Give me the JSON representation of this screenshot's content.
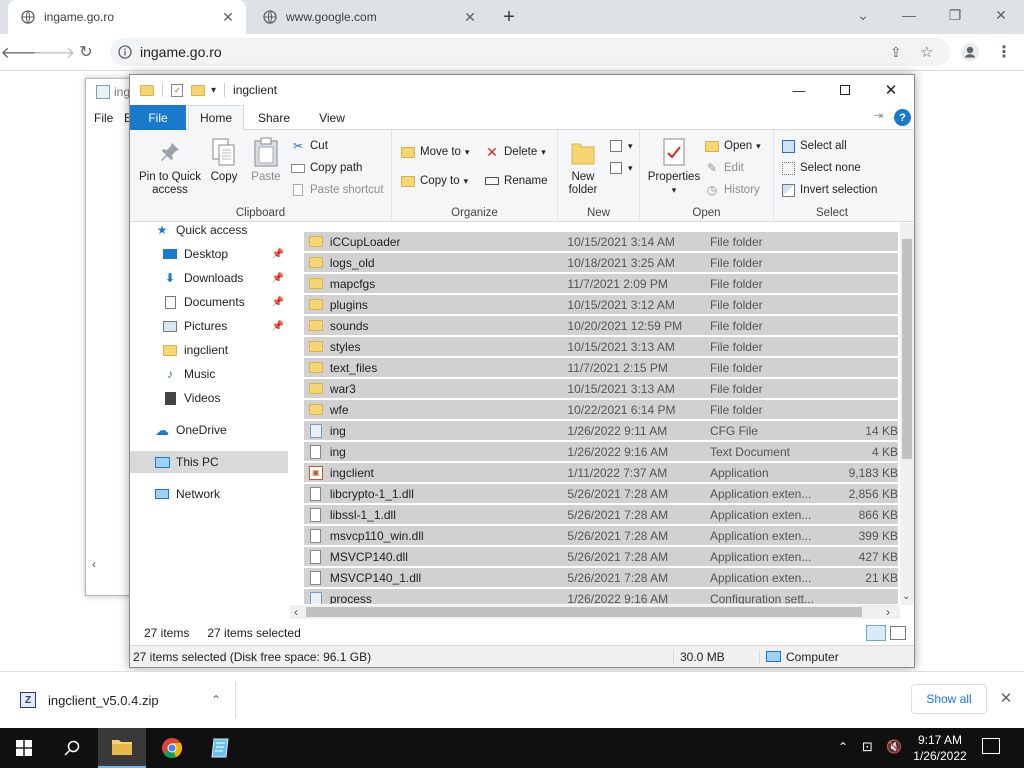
{
  "browser": {
    "tabs": [
      {
        "title": "ingame.go.ro",
        "active": true
      },
      {
        "title": "www.google.com",
        "active": false
      }
    ],
    "url": "ingame.go.ro"
  },
  "background_window": {
    "title_partial": "ing",
    "menu_file": "File",
    "menu_edit_partial": "E"
  },
  "explorer": {
    "title": "ingclient",
    "ribbon_tabs": [
      "File",
      "Home",
      "Share",
      "View"
    ],
    "clipboard": {
      "pin_label": "Pin to Quick access",
      "copy_label": "Copy",
      "paste_label": "Paste",
      "cut_label": "Cut",
      "copy_path_label": "Copy path",
      "paste_shortcut_label": "Paste shortcut",
      "group_label": "Clipboard"
    },
    "organize": {
      "move_to": "Move to",
      "copy_to": "Copy to",
      "delete": "Delete",
      "rename": "Rename",
      "group_label": "Organize"
    },
    "new": {
      "new_folder": "New folder",
      "group_label": "New"
    },
    "open": {
      "properties": "Properties",
      "open": "Open",
      "edit": "Edit",
      "history": "History",
      "group_label": "Open"
    },
    "select": {
      "select_all": "Select all",
      "select_none": "Select none",
      "invert_selection": "Invert selection",
      "group_label": "Select"
    },
    "nav": [
      {
        "label": "Quick access",
        "icon": "star-icon",
        "pinned": false
      },
      {
        "label": "Desktop",
        "icon": "desktop-icon",
        "pinned": true
      },
      {
        "label": "Downloads",
        "icon": "download-icon",
        "pinned": true
      },
      {
        "label": "Documents",
        "icon": "documents-icon",
        "pinned": true
      },
      {
        "label": "Pictures",
        "icon": "pictures-icon",
        "pinned": true
      },
      {
        "label": "ingclient",
        "icon": "folder-icon",
        "pinned": false
      },
      {
        "label": "Music",
        "icon": "music-icon",
        "pinned": false
      },
      {
        "label": "Videos",
        "icon": "videos-icon",
        "pinned": false
      },
      {
        "label": "OneDrive",
        "icon": "cloud-icon",
        "pinned": false
      },
      {
        "label": "This PC",
        "icon": "computer-icon",
        "pinned": false
      },
      {
        "label": "Network",
        "icon": "network-icon",
        "pinned": false
      }
    ],
    "files": [
      {
        "name": "iCCupLoader",
        "date": "10/15/2021 3:14 AM",
        "type": "File folder",
        "size": "",
        "icon": "folder-icon"
      },
      {
        "name": "logs_old",
        "date": "10/18/2021 3:25 AM",
        "type": "File folder",
        "size": "",
        "icon": "folder-icon"
      },
      {
        "name": "mapcfgs",
        "date": "11/7/2021 2:09 PM",
        "type": "File folder",
        "size": "",
        "icon": "folder-icon"
      },
      {
        "name": "plugins",
        "date": "10/15/2021 3:12 AM",
        "type": "File folder",
        "size": "",
        "icon": "folder-icon"
      },
      {
        "name": "sounds",
        "date": "10/20/2021 12:59 PM",
        "type": "File folder",
        "size": "",
        "icon": "folder-icon"
      },
      {
        "name": "styles",
        "date": "10/15/2021 3:13 AM",
        "type": "File folder",
        "size": "",
        "icon": "folder-icon"
      },
      {
        "name": "text_files",
        "date": "11/7/2021 2:15 PM",
        "type": "File folder",
        "size": "",
        "icon": "folder-icon"
      },
      {
        "name": "war3",
        "date": "10/15/2021 3:13 AM",
        "type": "File folder",
        "size": "",
        "icon": "folder-icon"
      },
      {
        "name": "wfe",
        "date": "10/22/2021 6:14 PM",
        "type": "File folder",
        "size": "",
        "icon": "folder-icon"
      },
      {
        "name": "ing",
        "date": "1/26/2022 9:11 AM",
        "type": "CFG File",
        "size": "14 KB",
        "icon": "config-file-icon"
      },
      {
        "name": "ing",
        "date": "1/26/2022 9:16 AM",
        "type": "Text Document",
        "size": "4 KB",
        "icon": "text-file-icon"
      },
      {
        "name": "ingclient",
        "date": "1/11/2022 7:37 AM",
        "type": "Application",
        "size": "9,183 KB",
        "icon": "application-icon"
      },
      {
        "name": "libcrypto-1_1.dll",
        "date": "5/26/2021 7:28 AM",
        "type": "Application exten...",
        "size": "2,856 KB",
        "icon": "dll-file-icon"
      },
      {
        "name": "libssl-1_1.dll",
        "date": "5/26/2021 7:28 AM",
        "type": "Application exten...",
        "size": "866 KB",
        "icon": "dll-file-icon"
      },
      {
        "name": "msvcp110_win.dll",
        "date": "5/26/2021 7:28 AM",
        "type": "Application exten...",
        "size": "399 KB",
        "icon": "dll-file-icon"
      },
      {
        "name": "MSVCP140.dll",
        "date": "5/26/2021 7:28 AM",
        "type": "Application exten...",
        "size": "427 KB",
        "icon": "dll-file-icon"
      },
      {
        "name": "MSVCP140_1.dll",
        "date": "5/26/2021 7:28 AM",
        "type": "Application exten...",
        "size": "21 KB",
        "icon": "dll-file-icon"
      },
      {
        "name": "process",
        "date": "1/26/2022 9:16 AM",
        "type": "Configuration sett...",
        "size": "",
        "icon": "config-file-icon"
      }
    ],
    "status": {
      "items": "27 items",
      "selected": "27 items selected",
      "details_left": "27 items selected (Disk free space: 96.1 GB)",
      "details_size": "30.0 MB",
      "details_location": "Computer"
    }
  },
  "download_shelf": {
    "filename": "ingclient_v5.0.4.zip",
    "show_all": "Show all"
  },
  "taskbar": {
    "time": "9:17 AM",
    "date": "1/26/2022"
  },
  "colors": {
    "file_tab": "#1979ca",
    "selection": "#d1d1d1",
    "taskbar": "#101010",
    "folder": "#f7d672"
  }
}
